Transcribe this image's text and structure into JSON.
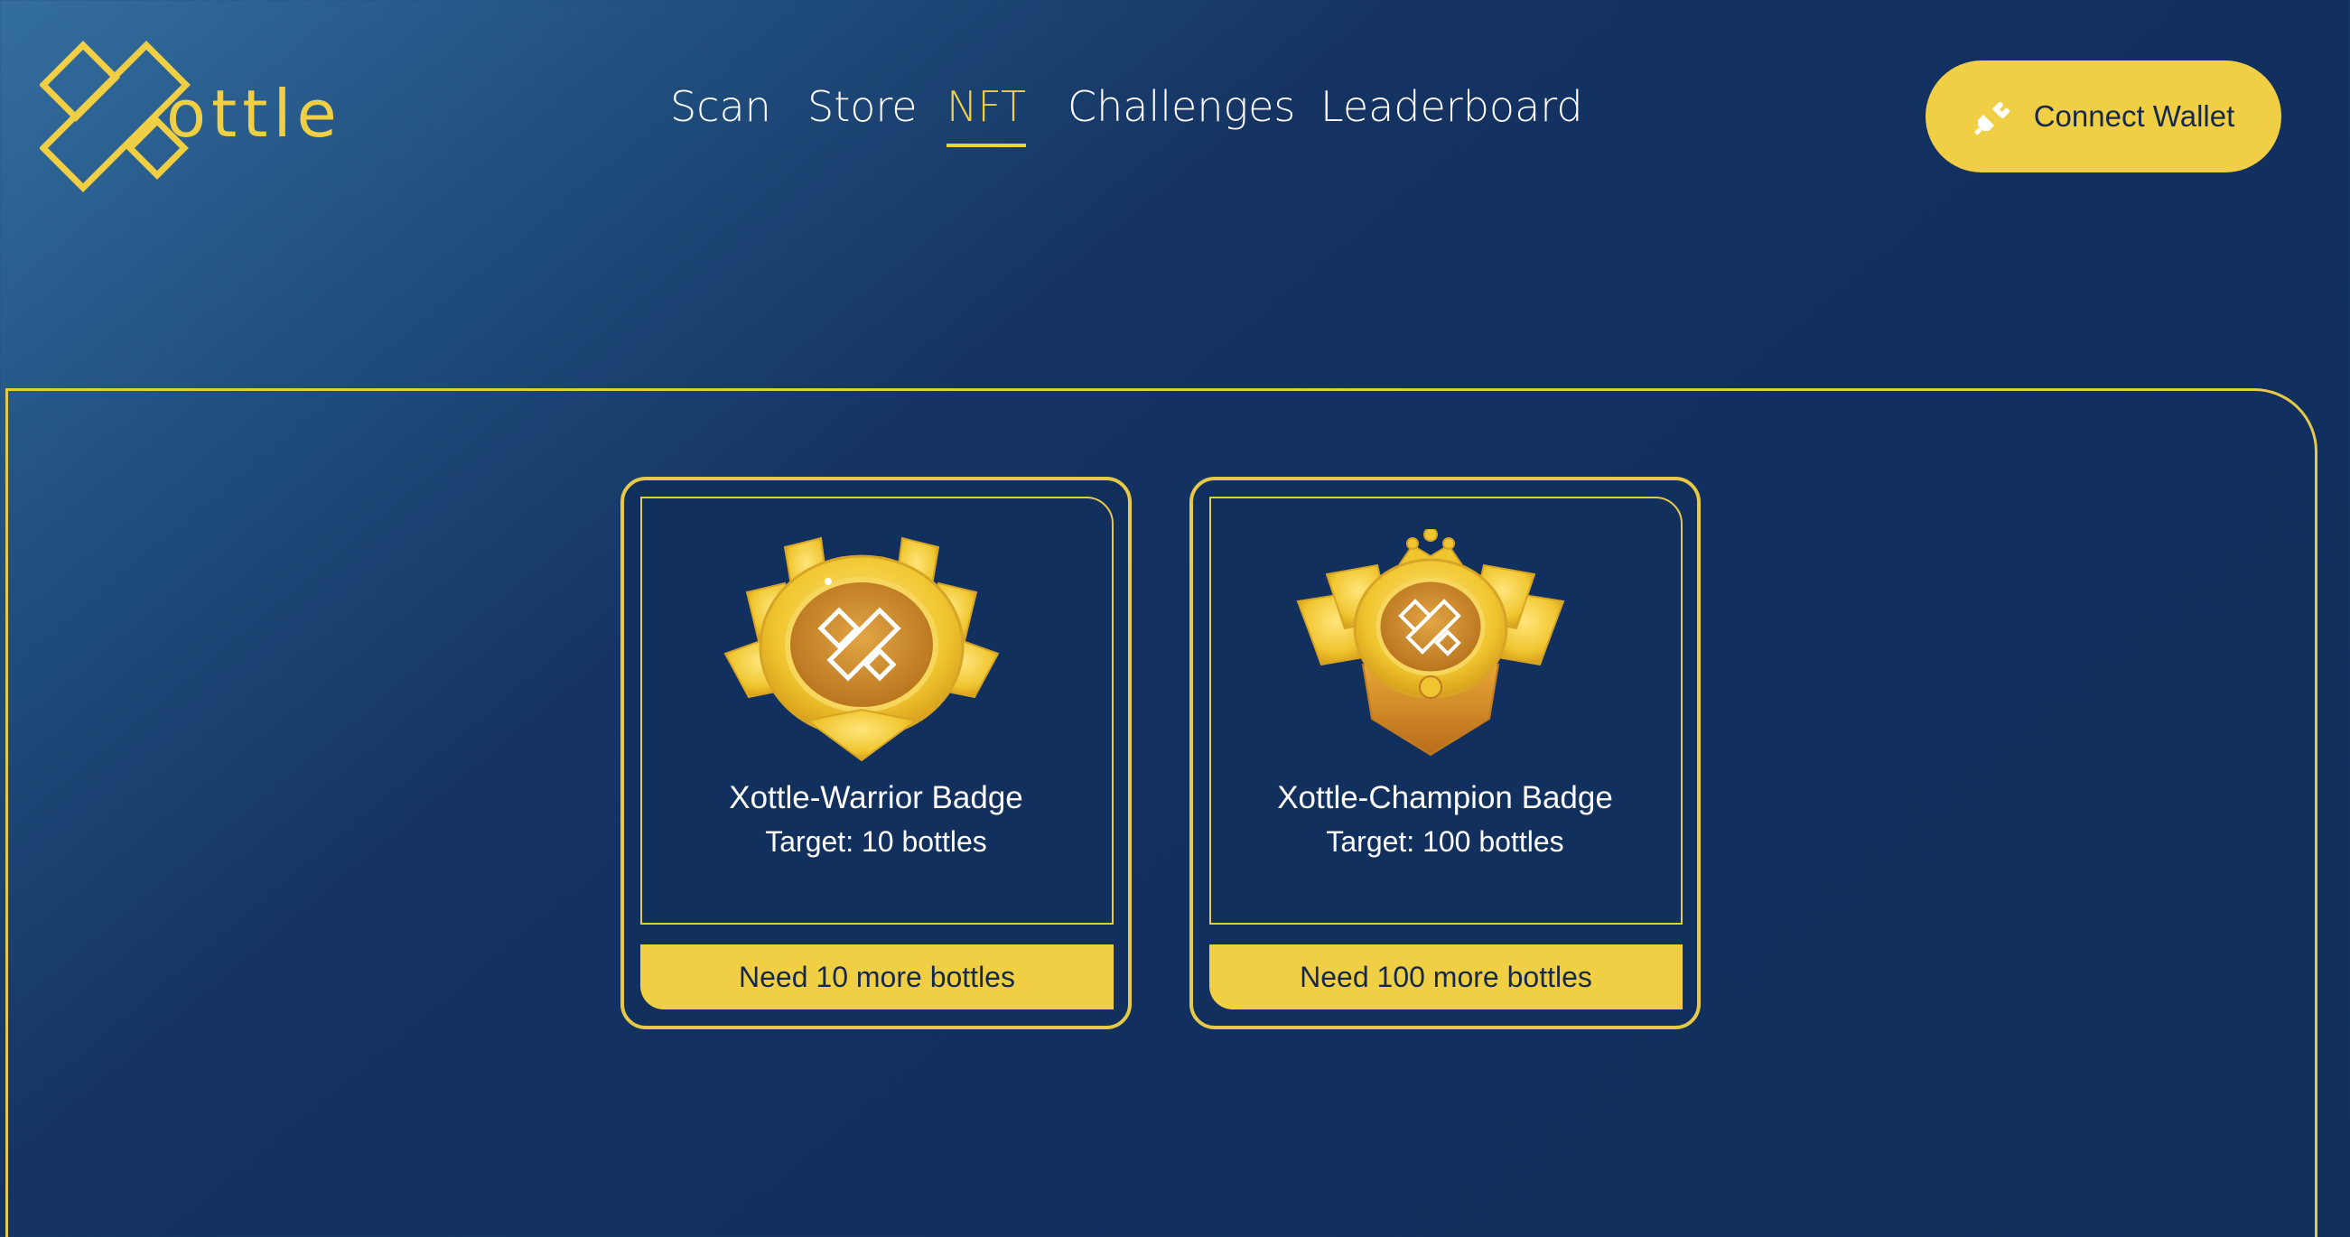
{
  "brand": {
    "logo_text": "ottle",
    "accent": "#f0cf44",
    "background": "#12305e"
  },
  "nav": {
    "items": [
      {
        "label": "Scan",
        "active": false
      },
      {
        "label": "Store",
        "active": false
      },
      {
        "label": "NFT",
        "active": true
      },
      {
        "label": "Challenges",
        "active": false
      },
      {
        "label": "Leaderboard",
        "active": false
      }
    ]
  },
  "wallet": {
    "label": "Connect Wallet",
    "icon": "plug-icon"
  },
  "badges": [
    {
      "title": "Xottle-Warrior Badge",
      "target": "Target: 10 bottles",
      "action": "Need 10 more bottles",
      "icon": "warrior-badge-icon"
    },
    {
      "title": "Xottle-Champion Badge",
      "target": "Target: 100 bottles",
      "action": "Need 100 more bottles",
      "icon": "champion-badge-icon"
    }
  ]
}
